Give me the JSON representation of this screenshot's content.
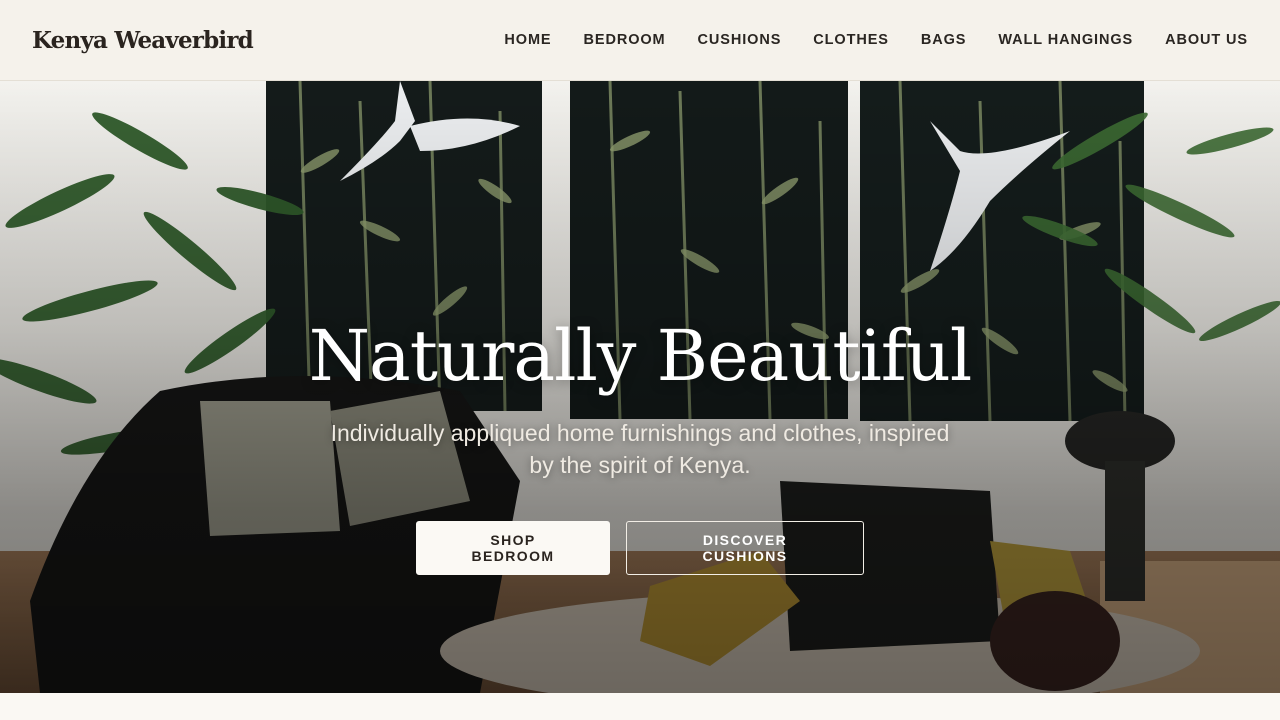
{
  "header": {
    "logo": "Kenya Weaverbird",
    "nav": [
      {
        "label": "HOME"
      },
      {
        "label": "BEDROOM"
      },
      {
        "label": "CUSHIONS"
      },
      {
        "label": "CLOTHES"
      },
      {
        "label": "BAGS"
      },
      {
        "label": "WALL HANGINGS"
      },
      {
        "label": "ABOUT US"
      }
    ]
  },
  "hero": {
    "title": "Naturally Beautiful",
    "subtitle": "Individually appliqued home furnishings and clothes, inspired by the spirit of Kenya.",
    "primary_button": "SHOP BEDROOM",
    "secondary_button": "DISCOVER CUSHIONS"
  },
  "colors": {
    "header_bg": "#f5f2eb",
    "text_dark": "#2a241f",
    "button_light": "#fbf9f4"
  }
}
